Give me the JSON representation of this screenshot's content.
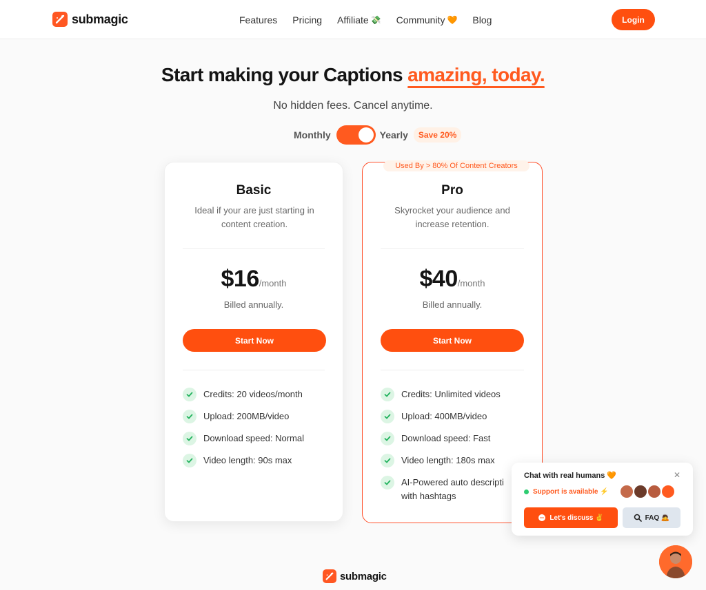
{
  "header": {
    "logo_text": "submagic",
    "nav": [
      {
        "label": "Features",
        "emoji": ""
      },
      {
        "label": "Pricing",
        "emoji": ""
      },
      {
        "label": "Affiliate",
        "emoji": "💸"
      },
      {
        "label": "Community",
        "emoji": "🧡"
      },
      {
        "label": "Blog",
        "emoji": ""
      }
    ],
    "login_label": "Login"
  },
  "hero": {
    "title_prefix": "Start making your Captions ",
    "title_accent": "amazing, today.",
    "subtitle": "No hidden fees. Cancel anytime."
  },
  "billing_toggle": {
    "monthly_label": "Monthly",
    "yearly_label": "Yearly",
    "save_label": "Save 20%",
    "selected": "Yearly"
  },
  "plans": [
    {
      "name": "Basic",
      "description": "Ideal if your are just starting in content creation.",
      "price": "$16",
      "unit": "/month",
      "billed": "Billed annually.",
      "cta": "Start Now",
      "features": [
        "Credits: 20 videos/month",
        "Upload: 200MB/video",
        "Download speed: Normal",
        "Video length: 90s max"
      ]
    },
    {
      "name": "Pro",
      "badge": "Used By > 80% Of Content Creators",
      "description": "Skyrocket your audience and increase retention.",
      "price": "$40",
      "unit": "/month",
      "billed": "Billed annually.",
      "cta": "Start Now",
      "features": [
        "Credits: Unlimited videos",
        "Upload: 400MB/video",
        "Download speed: Fast",
        "Video length: 180s max",
        "AI-Powered auto descripti with hashtags"
      ]
    }
  ],
  "chat": {
    "title": "Chat with real humans 🧡",
    "status": "Support is available ⚡",
    "primary_button": "Let's discuss ✌️",
    "secondary_button": "FAQ 🙇"
  },
  "footer": {
    "logo_text": "submagic"
  },
  "colors": {
    "accent": "#ff5a1f",
    "button": "#ff4f0f",
    "check_bg": "#dcf5e4",
    "check": "#22b35e"
  }
}
